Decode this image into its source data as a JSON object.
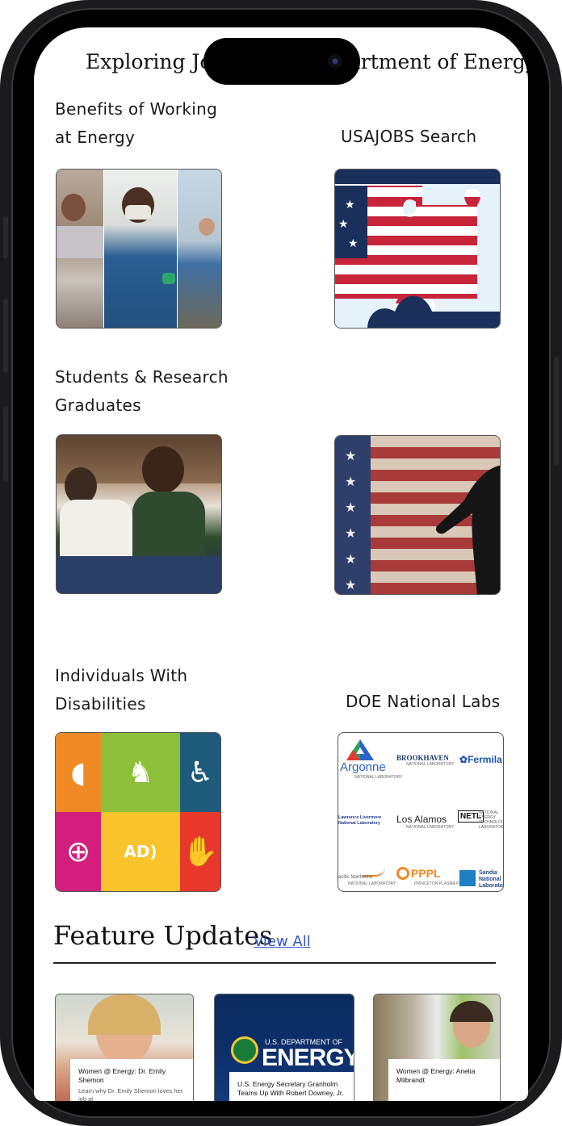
{
  "page": {
    "title": "Exploring Jobs at the Department of Energy"
  },
  "categories": [
    {
      "line1": "Benefits of Working",
      "line2": "at Energy",
      "image": "collage of energy employees at work"
    },
    {
      "line1": "USAJOBS Search",
      "line2": "",
      "image": "american flag puzzle piece"
    },
    {
      "line1": "Students & Research",
      "line2": "Graduates",
      "image": "smiling students in classroom"
    },
    {
      "line1": "",
      "line2": "",
      "image": "soldier silhouette saluting american flag"
    },
    {
      "line1": "Individuals With",
      "line2": "Disabilities",
      "image": "accessibility icons grid"
    },
    {
      "line1": "DOE National Labs",
      "line2": "",
      "image": "national laboratory logos"
    }
  ],
  "labs": {
    "argonne": "Argonne",
    "argonne_sub": "NATIONAL LABORATORY",
    "brookhaven": "BROOKHAVEN",
    "brookhaven_sub": "NATIONAL LABORATORY",
    "fermilab": "Fermila",
    "lbnl": "Lawrence Livermore National Laboratory",
    "losalamos": "Los Alamos",
    "losalamos_sub": "NATIONAL LABORATORY",
    "netl": "NETL",
    "netl_sub": "NATIONAL ENERGY TECHNOLOGY LABORATORY",
    "pnnl": "acific Northwest",
    "pnnl_sub": "NATIONAL LABORATORY",
    "pppl": "PPPL",
    "pppl_sub": "PRINCETON PLASMA PHYSICS",
    "sandia": "Sandia National Laboratori"
  },
  "feature": {
    "title": "Feature Updates",
    "view_all": "View All",
    "cards": [
      {
        "title": "Women @ Energy: Dr. Emily Shemon",
        "subtitle": "Learn why Dr. Emily Shemon loves her job at"
      },
      {
        "title": "U.S. Energy Secretary Granholm Teams Up With Robert Downey, Jr.",
        "subtitle": "",
        "badge_top": "U.S. DEPARTMENT OF",
        "badge_main": "ENERGY"
      },
      {
        "title": "Women @ Energy: Anelia Milbrandt",
        "subtitle": ""
      }
    ]
  },
  "colors": {
    "link": "#2f55c9",
    "flag_red": "#c8243a",
    "flag_blue": "#1b2f5b",
    "doe_blue": "#0d2f6b"
  }
}
